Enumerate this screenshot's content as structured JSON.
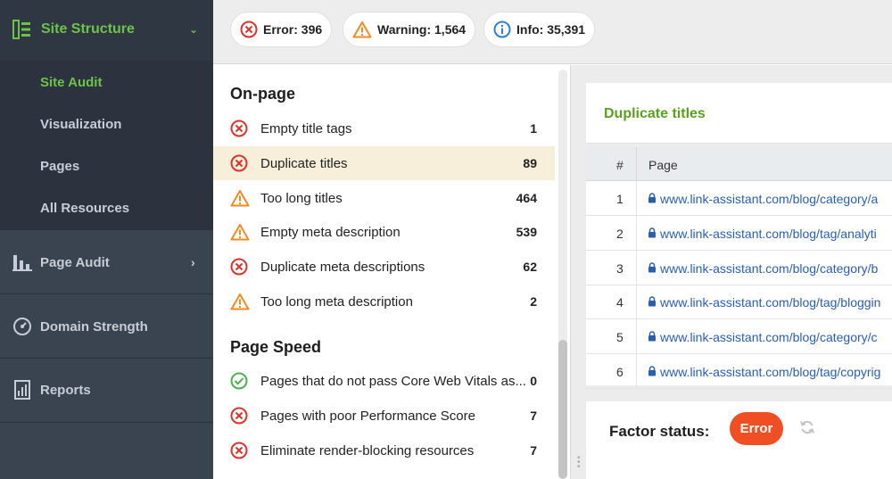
{
  "sidebar": {
    "header": {
      "title": "Site Structure",
      "icon": "site-structure-icon",
      "chevron": "chevron-down-icon"
    },
    "subitems": [
      {
        "label": "Site Audit",
        "active": true
      },
      {
        "label": "Visualization",
        "active": false
      },
      {
        "label": "Pages",
        "active": false
      },
      {
        "label": "All Resources",
        "active": false
      }
    ],
    "sections": [
      {
        "label": "Page Audit",
        "icon": "page-audit-icon",
        "has_chevron": true
      },
      {
        "label": "Domain Strength",
        "icon": "gauge-icon",
        "has_chevron": false
      },
      {
        "label": "Reports",
        "icon": "reports-icon",
        "has_chevron": false
      }
    ]
  },
  "summary": {
    "error": {
      "label": "Error: 396",
      "icon": "error-icon"
    },
    "warning": {
      "label": "Warning: 1,564",
      "icon": "warning-icon"
    },
    "info": {
      "label": "Info: 35,391",
      "icon": "info-icon"
    }
  },
  "factors": {
    "onpage": {
      "title": "On-page",
      "items": [
        {
          "label": "Empty title tags",
          "count": "1",
          "status": "error"
        },
        {
          "label": "Duplicate titles",
          "count": "89",
          "status": "error",
          "selected": true
        },
        {
          "label": "Too long titles",
          "count": "464",
          "status": "warning"
        },
        {
          "label": "Empty meta description",
          "count": "539",
          "status": "warning"
        },
        {
          "label": "Duplicate meta descriptions",
          "count": "62",
          "status": "error"
        },
        {
          "label": "Too long meta description",
          "count": "2",
          "status": "warning"
        }
      ]
    },
    "pagespeed": {
      "title": "Page Speed",
      "items": [
        {
          "label": "Pages that do not pass Core Web Vitals as...",
          "count": "0",
          "status": "ok"
        },
        {
          "label": "Pages with poor Performance Score",
          "count": "7",
          "status": "error"
        },
        {
          "label": "Eliminate render-blocking resources",
          "count": "7",
          "status": "error"
        }
      ]
    }
  },
  "details": {
    "title": "Duplicate titles",
    "columns": {
      "num": "#",
      "page": "Page"
    },
    "rows": [
      {
        "n": "1",
        "url": "www.link-assistant.com/blog/category/a"
      },
      {
        "n": "2",
        "url": "www.link-assistant.com/blog/tag/analyti"
      },
      {
        "n": "3",
        "url": "www.link-assistant.com/blog/category/b"
      },
      {
        "n": "4",
        "url": "www.link-assistant.com/blog/tag/bloggin"
      },
      {
        "n": "5",
        "url": "www.link-assistant.com/blog/category/c"
      },
      {
        "n": "6",
        "url": "www.link-assistant.com/blog/tag/copyrig"
      }
    ],
    "factor_status_label": "Factor status:",
    "factor_status_value": "Error"
  },
  "colors": {
    "accent_green": "#6cc24a",
    "error_red": "#d9342b",
    "warning_orange": "#f08a24",
    "info_blue": "#2f7fd0",
    "ok_green": "#4caf50",
    "selected_row": "#f7efda",
    "pill_orange": "#f04e23"
  }
}
